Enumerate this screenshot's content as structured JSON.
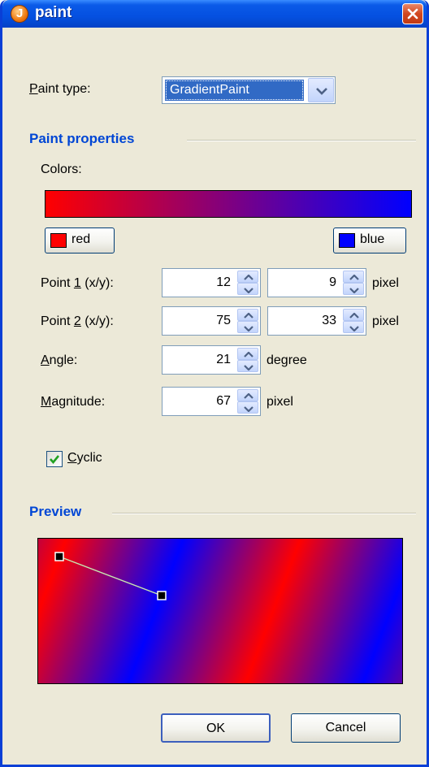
{
  "window": {
    "title": "paint",
    "close_icon": "close-icon",
    "app_icon": "java-icon"
  },
  "paint_type": {
    "label_prefix": "",
    "label_mnemonic": "P",
    "label_rest": "aint type:",
    "selected": "GradientPaint"
  },
  "paint_properties": {
    "section_title": "Paint properties",
    "colors_label": "Colors:",
    "gradient": {
      "start": "#ff0000",
      "end": "#0000ff"
    },
    "color1": {
      "label": "red",
      "swatch": "#ff0000"
    },
    "color2": {
      "label": "blue",
      "swatch": "#0000ff"
    },
    "point1": {
      "label_a": "Point ",
      "mnemonic": "1",
      "label_b": " (x/y):",
      "x": "12",
      "y": "9",
      "unit": "pixel"
    },
    "point2": {
      "label_a": "Point ",
      "mnemonic": "2",
      "label_b": " (x/y):",
      "x": "75",
      "y": "33",
      "unit": "pixel"
    },
    "angle": {
      "mnemonic": "A",
      "label_rest": "ngle:",
      "value": "21",
      "unit": "degree"
    },
    "magnitude": {
      "mnemonic": "M",
      "label_rest": "agnitude:",
      "value": "67",
      "unit": "pixel"
    },
    "cyclic": {
      "mnemonic": "C",
      "label_rest": "yclic",
      "checked": true
    }
  },
  "preview": {
    "section_title": "Preview"
  },
  "buttons": {
    "ok": "OK",
    "cancel": "Cancel"
  },
  "colors": {
    "accent": "#0046d5",
    "title_bar": "#0550e0",
    "background": "#ece9d8"
  }
}
